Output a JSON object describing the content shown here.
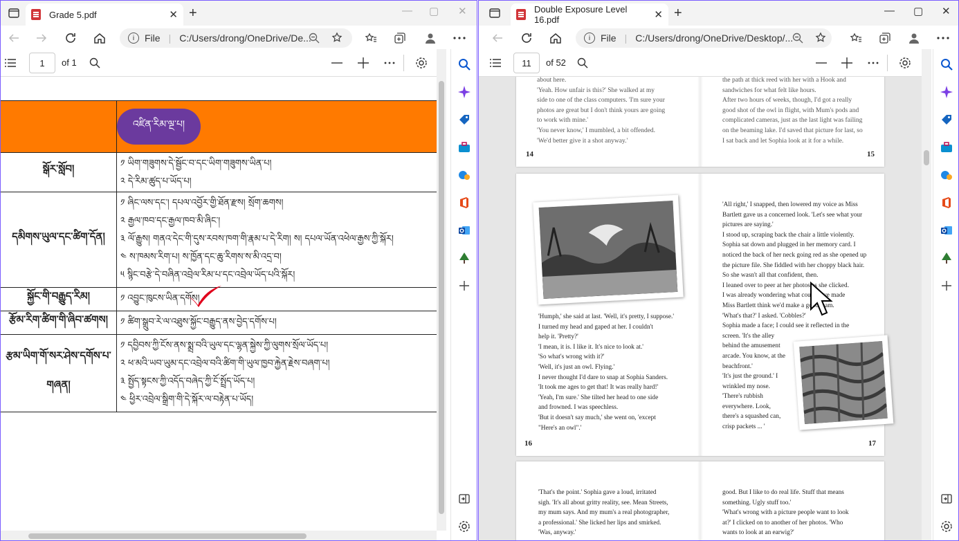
{
  "left": {
    "tab_title": "Grade 5.pdf",
    "address_label": "File",
    "url": "C:/Users/drong/OneDrive/De...",
    "page_input": "1",
    "page_of": "of 1",
    "table": {
      "header_pill": "འཛིན་རིམ་ལྔ་པ།",
      "rows": [
        {
          "head": "སྒོར་སློབ།",
          "lines": [
            "༡ ཡིག་གཟུགས་དེ་སྦྱོང་བ་དང་ཡིག་གཟུགས་ཡིན་པ།",
            "༢ དེ་རིམ་ཚུད་པ་ཡོད་པ།"
          ]
        },
        {
          "head": "དམིགས་ཡུལ་དང་ཚིག་དོན།",
          "lines": [
            "༡ ཞིང་ལས་དང་། དཔལ་འབྱོར་གྱི་ཐོན་རྫས། སྲོག་ཆགས།",
            "༢ རྒྱལ་ཁབ་དང་རྒྱལ་ཁབ་མི་ཞིང་།",
            "༣ ལོ་རྒྱུས། གནའ་དེང་གི་དུས་རབས་ཁག་གི་རྣམ་པ་དེ་རིག། ས། དཔལ་ཡོན་འཕེལ་རྒྱས་ཀྱི་སྐོར།",
            "༤ ས་ཁམས་རིག་པ། ས་ཁྱོན་དང་ཆུ་རིགས་ས་མི་འདྲ་བ།",
            "༥ སྙིང་བརྩེ་དེ་བཞིན་འབྲེལ་རིམ་པ་དང་འབྲེལ་ཡོད་པའི་སྐོར།"
          ]
        },
        {
          "head": "སྐྱོང་གི་བརྒྱུད་རིམ།",
          "lines": [
            "༡ འབྱུང་ཁུངས་ཡིན་དགོས།"
          ]
        },
        {
          "head": "རྩོམ་རིག་ཚིག་གི་ཞིབ་ཚགས།",
          "lines": [
            "༡ ཚིག་སྒྲུབ་རེ་ལ་འཐུས་སྐྱོང་བརྒྱུད་ནས་བྱེད་དགོས་པ།"
          ]
        },
        {
          "head": "རྩམ་ཡིག་གོ་སར་ཤེས་དགོས་པ་གཞན།",
          "lines": [
            "༡ དབྱིབས་ཀྱི་ངོས་ནས་སྨྲ་བའི་ཡུལ་དང་ལྷན་སྐྱེས་ཀྱི་ལུགས་སྲོལ་ཡོད་པ།",
            "༢ ཕ་མའི་ཡབ་ཡུམ་དང་འབྲེལ་བའི་ཚིག་གི་ཡུལ་ཁྱབ་རྐྱེན་རྗེས་བཞག་པ།",
            "༣ སྤྱོད་སྟངས་ཀྱི་འདོད་བཞེད་ཀྱི་ངོ་སྤྲོད་ཡོད་པ།",
            "༤ ཕྱིར་འབྲེལ་སྒྲིག་གི་དེ་སྐོར་ལ་བརྟེན་པ་ཡོད།"
          ]
        }
      ]
    }
  },
  "right": {
    "tab_title": "Double Exposure Level 16.pdf",
    "address_label": "File",
    "url": "C:/Users/drong/OneDrive/Desktop/...",
    "page_input": "11",
    "page_of": "of 52",
    "pages": [
      {
        "left_text": [
          "about here.",
          "'Yeah. How unfair is this?' She walked at my",
          "side to one of the class computers. 'I'm sure your",
          "photos are great but I don't think yours are going",
          "to work with mine.'",
          "'You never know,' I mumbled, a bit offended.",
          "'We'd better give it a shot anyway.'"
        ],
        "right_text": [
          "the path at thick reed with her with a Hook and",
          "sandwiches for what felt like hours.",
          "After two hours of weeks, though, I'd got a really",
          "good shot of the owl in flight, with Mum's pods and",
          "complicated cameras, just as the last light was failing",
          "on the beaming lake. I'd saved that picture for last, so",
          "I sat back and let Sophia look at it for a while."
        ],
        "left_num": "14",
        "right_num": "15"
      },
      {
        "left_text": [
          "'Humph,' she said at last. 'Well, it's pretty, I suppose.'",
          "I turned my head and gaped at her. I couldn't",
          "help it. 'Pretty?'",
          "'I mean, it is. I like it. It's nice to look at.'",
          "'So what's wrong with it?'",
          "'Well, it's just an owl. Flying.'",
          "I never thought I'd dare to snap at Sophia Sanders.",
          "'It took me ages to get that! It was really hard!'",
          "'Yeah, I'm sure.' She tilted her head to one side",
          "and frowned. I was speechless.",
          "'But it doesn't say much,' she went on, 'except",
          "\"Here's an owl\".'"
        ],
        "right_text": [
          "'All right,' I snapped, then lowered my voice as Miss",
          "Bartlett gave us a concerned look. 'Let's see what your",
          "pictures are saying.'",
          "I stood up, scraping back the chair a little violently.",
          "Sophia sat down and plugged in her memory card. I",
          "noticed the back of her neck going red as she opened up",
          "the picture file. She fiddled with her choppy black hair.",
          "So she wasn't all that confident, then.",
          "I leaned over to peer at her photos as she clicked.",
          "I was already wondering what could have made",
          "Miss Bartlett think we'd make a good team.",
          "'What's that?' I asked. 'Cobbles?'",
          "Sophia made a face; I could see it reflected in the",
          "screen. 'It's the alley",
          "behind the amusement",
          "arcade. You know, at the",
          "beachfront.'",
          "'It's just the ground.' I",
          "wrinkled my nose.",
          "'There's rubbish",
          "everywhere. Look,",
          "there's a squashed can,",
          "crisp packets ... '"
        ],
        "left_num": "16",
        "right_num": "17"
      },
      {
        "left_text": [
          "'That's the point.' Sophia gave a loud, irritated",
          "sigh. 'It's all about gritty reality, see. Mean Streets,",
          "my mum says. And my mum's a real photographer,",
          "a professional.' She licked her lips and smirked.",
          "'Was, anyway.'"
        ],
        "right_text": [
          "good. But I like to do real life. Stuff that means",
          "something. Ugly stuff too.'",
          "'What's wrong with a picture people want to look",
          "at?' I clicked on to another of her photos. 'Who",
          "wants to look at an earwig?'"
        ],
        "left_num": "",
        "right_num": ""
      }
    ]
  },
  "sidebar_icons": [
    "search-icon",
    "copilot-icon",
    "tag-icon",
    "toolbox-icon",
    "games-icon",
    "office-icon",
    "outlook-icon",
    "tree-icon",
    "add-icon"
  ],
  "colors": {
    "table_header": "#ff7a00",
    "pill": "#6b3a9e",
    "check": "#e0001b",
    "accent": "#0b57d0"
  }
}
